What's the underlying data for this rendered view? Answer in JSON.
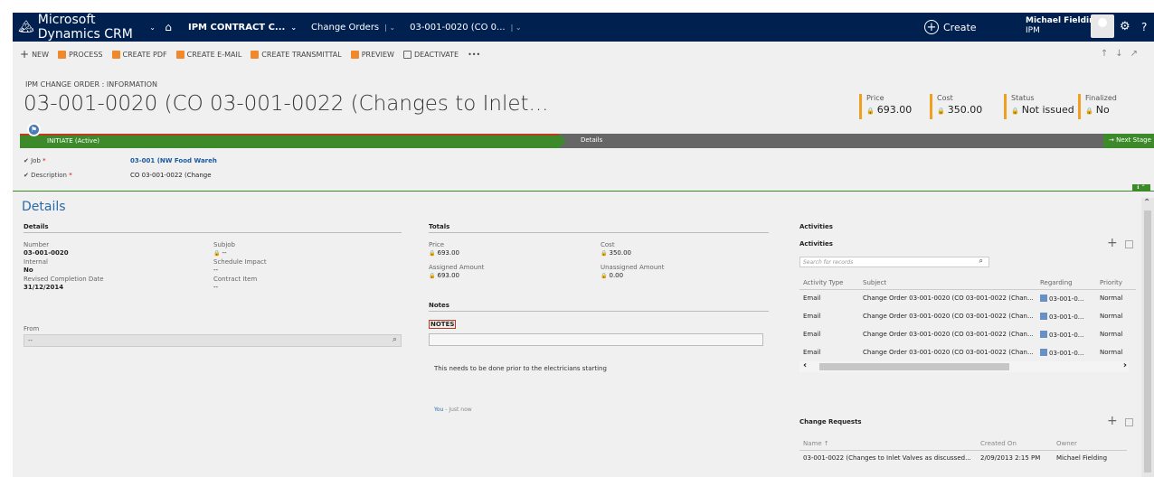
{
  "nav": {
    "brand": "Microsoft Dynamics CRM",
    "area": "IPM CONTRACT C...",
    "entity": "Change Orders",
    "record": "03-001-0020 (CO 0...",
    "create_label": "Create",
    "user_name": "Michael Fielding",
    "user_org": "IPM"
  },
  "commands": {
    "new": "NEW",
    "process": "PROCESS",
    "create_pdf": "CREATE PDF",
    "create_email": "CREATE E-MAIL",
    "create_transmittal": "CREATE TRANSMITTAL",
    "preview": "PREVIEW",
    "deactivate": "DEACTIVATE",
    "more": "•••"
  },
  "header": {
    "form_type": "IPM CHANGE ORDER : INFORMATION",
    "title": "03-001-0020 (CO 03-001-0022 (Changes to Inlet...",
    "price_label": "Price",
    "price_value": "693.00",
    "cost_label": "Cost",
    "cost_value": "350.00",
    "status_label": "Status",
    "status_value": "Not issued",
    "finalized_label": "Finalized",
    "finalized_value": "No"
  },
  "process": {
    "stage_active": "INITIATE (Active)",
    "stage_next": "Details",
    "next_stage": "Next Stage",
    "job_label": "Job",
    "job_value": "03-001 (NW Food Wareh",
    "desc_label": "Description",
    "desc_value": "CO 03-001-0022 (Change"
  },
  "details": {
    "section_title": "Details",
    "sub_header": "Details",
    "number_label": "Number",
    "number_value": "03-001-0020",
    "internal_label": "Internal",
    "internal_value": "No",
    "revised_label": "Revised Completion Date",
    "revised_value": "31/12/2014",
    "subjob_label": "Subjob",
    "subjob_value": "--",
    "schedule_label": "Schedule Impact",
    "schedule_value": "--",
    "contract_label": "Contract Item",
    "contract_value": "--",
    "from_label": "From",
    "from_value": "--"
  },
  "totals": {
    "header": "Totals",
    "price_label": "Price",
    "price_value": "693.00",
    "cost_label": "Cost",
    "cost_value": "350.00",
    "assigned_label": "Assigned Amount",
    "assigned_value": "693.00",
    "unassigned_label": "Unassigned Amount",
    "unassigned_value": "0.00"
  },
  "notes": {
    "header": "Notes",
    "tab": "NOTES",
    "text": "This needs to be done prior to the electricians starting",
    "author": "You",
    "time": "Just now"
  },
  "activities": {
    "header": "Activities",
    "grid_title": "Activities",
    "search_placeholder": "Search for records",
    "columns": [
      "Activity Type",
      "Subject",
      "Regarding",
      "Priority"
    ],
    "rows": [
      [
        "Email",
        "Change Order 03-001-0020 (CO 03-001-0022 (Chan...",
        "03-001-0...",
        "Normal"
      ],
      [
        "Email",
        "Change Order 03-001-0020 (CO 03-001-0022 (Chan...",
        "03-001-0...",
        "Normal"
      ],
      [
        "Email",
        "Change Order 03-001-0020 (CO 03-001-0022 (Chan...",
        "03-001-0...",
        "Normal"
      ],
      [
        "Email",
        "Change Order 03-001-0020 (CO 03-001-0022 (Chan...",
        "03-001-0...",
        "Normal"
      ]
    ]
  },
  "change_requests": {
    "title": "Change Requests",
    "columns": [
      "Name ↑",
      "Created On",
      "Owner"
    ],
    "rows": [
      [
        "03-001-0022 (Changes to Inlet Valves as discussed...",
        "2/09/2013 2:15 PM",
        "Michael Fielding"
      ]
    ]
  }
}
